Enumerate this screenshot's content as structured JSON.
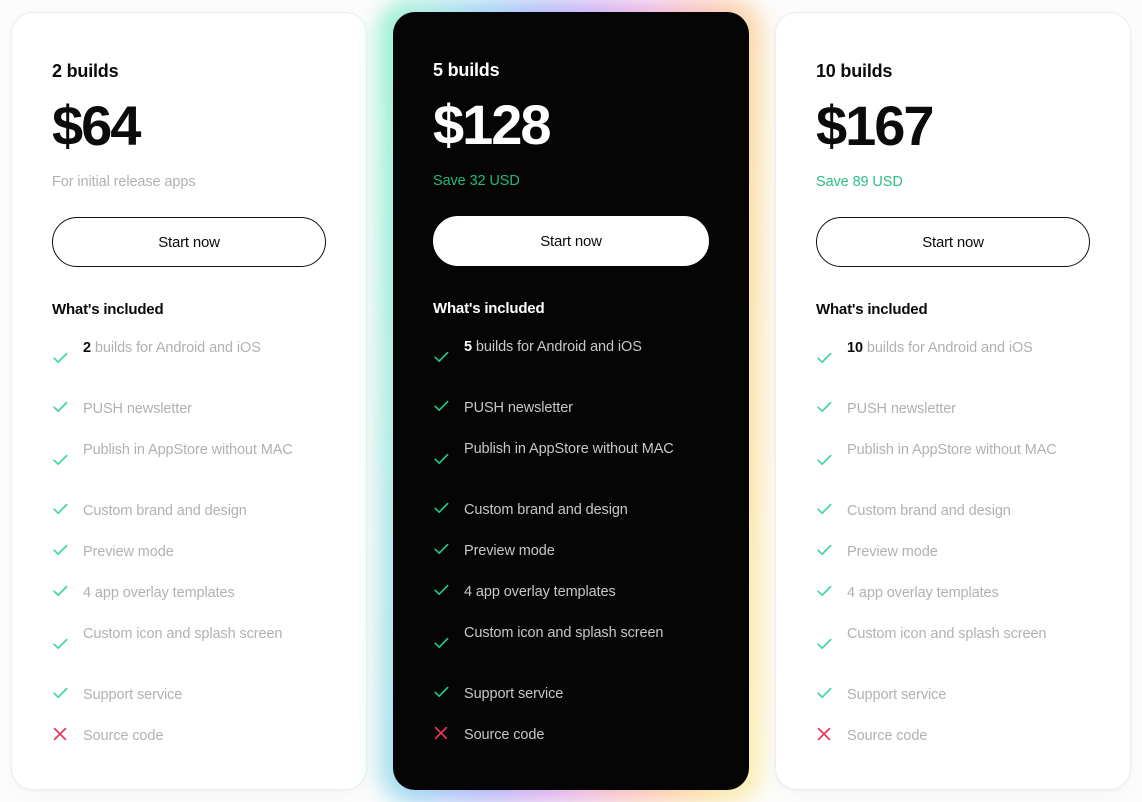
{
  "colors": {
    "page_bg": "#FCFCFC",
    "card_light_bg": "#FFFFFF",
    "card_dark_bg": "#050505",
    "check_green": "#43D4A0",
    "check_green_dark": "#22C57E",
    "cross_red": "#E8365D",
    "save_green": "#2CBF86",
    "muted_text": "#AFB1B4",
    "heading_text": "#0B0B0B"
  },
  "plans": [
    {
      "id": "plan-2-builds",
      "theme": "light",
      "featured": false,
      "name": "2 builds",
      "price": "$64",
      "subtitle": "For initial release apps",
      "subtitle_kind": "description",
      "cta_label": "Start now",
      "included_title": "What's included",
      "features": [
        {
          "icon": "check-icon",
          "included": true,
          "emphasis": "2",
          "text": " builds for Android and iOS"
        },
        {
          "icon": "check-icon",
          "included": true,
          "emphasis": "",
          "text": "PUSH newsletter"
        },
        {
          "icon": "check-icon",
          "included": true,
          "emphasis": "",
          "text": "Publish in AppStore without MAC"
        },
        {
          "icon": "check-icon",
          "included": true,
          "emphasis": "",
          "text": "Custom brand and design"
        },
        {
          "icon": "check-icon",
          "included": true,
          "emphasis": "",
          "text": "Preview mode"
        },
        {
          "icon": "check-icon",
          "included": true,
          "emphasis": "",
          "text": "4 app overlay templates"
        },
        {
          "icon": "check-icon",
          "included": true,
          "emphasis": "",
          "text": "Custom icon and splash screen"
        },
        {
          "icon": "check-icon",
          "included": true,
          "emphasis": "",
          "text": "Support service"
        },
        {
          "icon": "cross-icon",
          "included": false,
          "emphasis": "",
          "text": "Source code"
        }
      ]
    },
    {
      "id": "plan-5-builds",
      "theme": "dark",
      "featured": true,
      "name": "5 builds",
      "price": "$128",
      "subtitle": "Save 32 USD",
      "subtitle_kind": "save",
      "cta_label": "Start now",
      "included_title": "What's included",
      "features": [
        {
          "icon": "check-icon",
          "included": true,
          "emphasis": "5",
          "text": " builds for Android and iOS"
        },
        {
          "icon": "check-icon",
          "included": true,
          "emphasis": "",
          "text": "PUSH newsletter"
        },
        {
          "icon": "check-icon",
          "included": true,
          "emphasis": "",
          "text": "Publish in AppStore without MAC"
        },
        {
          "icon": "check-icon",
          "included": true,
          "emphasis": "",
          "text": "Custom brand and design"
        },
        {
          "icon": "check-icon",
          "included": true,
          "emphasis": "",
          "text": "Preview mode"
        },
        {
          "icon": "check-icon",
          "included": true,
          "emphasis": "",
          "text": "4 app overlay templates"
        },
        {
          "icon": "check-icon",
          "included": true,
          "emphasis": "",
          "text": "Custom icon and splash screen"
        },
        {
          "icon": "check-icon",
          "included": true,
          "emphasis": "",
          "text": "Support service"
        },
        {
          "icon": "cross-icon",
          "included": false,
          "emphasis": "",
          "text": "Source code"
        }
      ]
    },
    {
      "id": "plan-10-builds",
      "theme": "light",
      "featured": false,
      "name": "10 builds",
      "price": "$167",
      "subtitle": "Save 89 USD",
      "subtitle_kind": "save",
      "cta_label": "Start now",
      "included_title": "What's included",
      "features": [
        {
          "icon": "check-icon",
          "included": true,
          "emphasis": "10",
          "text": " builds for Android and iOS"
        },
        {
          "icon": "check-icon",
          "included": true,
          "emphasis": "",
          "text": "PUSH newsletter"
        },
        {
          "icon": "check-icon",
          "included": true,
          "emphasis": "",
          "text": "Publish in AppStore without MAC"
        },
        {
          "icon": "check-icon",
          "included": true,
          "emphasis": "",
          "text": "Custom brand and design"
        },
        {
          "icon": "check-icon",
          "included": true,
          "emphasis": "",
          "text": "Preview mode"
        },
        {
          "icon": "check-icon",
          "included": true,
          "emphasis": "",
          "text": "4 app overlay templates"
        },
        {
          "icon": "check-icon",
          "included": true,
          "emphasis": "",
          "text": "Custom icon and splash screen"
        },
        {
          "icon": "check-icon",
          "included": true,
          "emphasis": "",
          "text": "Support service"
        },
        {
          "icon": "cross-icon",
          "included": false,
          "emphasis": "",
          "text": "Source code"
        }
      ]
    }
  ]
}
